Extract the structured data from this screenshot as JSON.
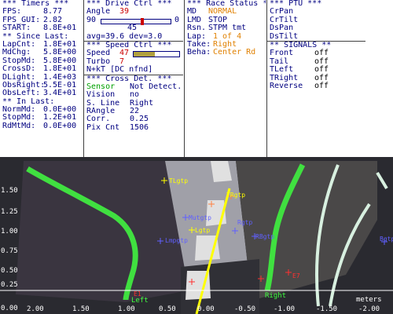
{
  "timers": {
    "header": "*** Timers ***",
    "fps_label": "FPS:",
    "fps_value": "8.77",
    "fps_gui_label": "FPS_GUI:",
    "fps_gui_value": "2.82",
    "start_label": "START:",
    "start_value": "8.8E+01",
    "since_header": "** Since Last:",
    "since": [
      {
        "label": "LapCnt:",
        "value": "1.8E+01"
      },
      {
        "label": "MdChg:",
        "value": "5.8E+00"
      },
      {
        "label": "StopMd:",
        "value": "5.8E+00"
      },
      {
        "label": "CrossD:",
        "value": "1.8E+01"
      },
      {
        "label": "DLight:",
        "value": "1.4E+03"
      },
      {
        "label": "ObsRight:",
        "value": "5.5E-01"
      },
      {
        "label": "ObsLeft:",
        "value": "3.4E+01"
      }
    ],
    "in_header": "** In Last:",
    "in_last": [
      {
        "label": "NormMd:",
        "value": "0.0E+00"
      },
      {
        "label": "StopMd:",
        "value": "1.2E+01"
      },
      {
        "label": "RdMtMd:",
        "value": "0.0E+00"
      }
    ]
  },
  "drive": {
    "header": "***  Drive Ctrl  ***",
    "angle_label": "Angle",
    "angle_value": "39",
    "slider_min": "90",
    "slider_max": "0",
    "slider_center": "45",
    "slider_fraction": 0.6,
    "avg_dev": "avg=39.6  dev=3.0",
    "speed_header": "***  Speed Ctrl  ***",
    "speed_label": "Speed",
    "speed_value": "47",
    "speed_fraction": 0.47,
    "turbo_label": "Turbo",
    "turbo_value": "7",
    "nxt_label": "N+kT [DC nfnd]",
    "cross_header": "*** Cross Det. ***",
    "cross": [
      {
        "label": "Sensor",
        "value": "Not Detect."
      },
      {
        "label": "Vision",
        "value": "no"
      },
      {
        "label": "S. Line",
        "value": "Right"
      },
      {
        "label": "RAngle",
        "value": "22"
      },
      {
        "label": "Corr.",
        "value": "0.25"
      },
      {
        "label": "Pix Cnt",
        "value": "1506"
      }
    ]
  },
  "race": {
    "header": "*** Race Status ***",
    "md_label": "MD",
    "md_value": "NORMAL",
    "lmd_label": "LMD",
    "lmd_value": "STOP",
    "rsn_label": "Rsn.",
    "rsn_value": "STPM tmt",
    "lap_label": "Lap:",
    "lap_value": "1 of 4",
    "take_label": "Take:",
    "take_value": "Right",
    "beha_label": "Beha:",
    "beha_value": "Center Rd"
  },
  "ptu": {
    "header": "*** PTU ***",
    "items": [
      "CrPan",
      "CrTilt",
      "DsPan",
      "DsTilt"
    ],
    "signals_header": "** SIGNALS **",
    "signals": [
      {
        "label": "Front",
        "value": "off"
      },
      {
        "label": "Tail",
        "value": "off"
      },
      {
        "label": "TLeft",
        "value": "off"
      },
      {
        "label": "TRight",
        "value": "off"
      },
      {
        "label": "Reverse",
        "value": "off"
      }
    ]
  },
  "view": {
    "y_ticks": [
      "1.50",
      "1.25",
      "1.00",
      "0.75",
      "0.50",
      "0.25",
      "0.00"
    ],
    "x_ticks": [
      "2.00",
      "1.50",
      "1.00",
      "0.50",
      "0.00",
      "-0.50",
      "-1.00",
      "-1.50",
      "-2.00"
    ],
    "units": "meters",
    "labels": {
      "tlgtp": "TLgtp",
      "trgtp": "TRgtp",
      "mutgtp": "Mutgtp",
      "lgtp": "Lgtp",
      "rgtp": "Rgtp",
      "rbgtp": "RBgtp",
      "lmpgtp": "Lmpgtp",
      "bgtp": "Bgtp",
      "left": "Left",
      "right": "Right",
      "e1": "E1",
      "e7": "E7"
    }
  }
}
